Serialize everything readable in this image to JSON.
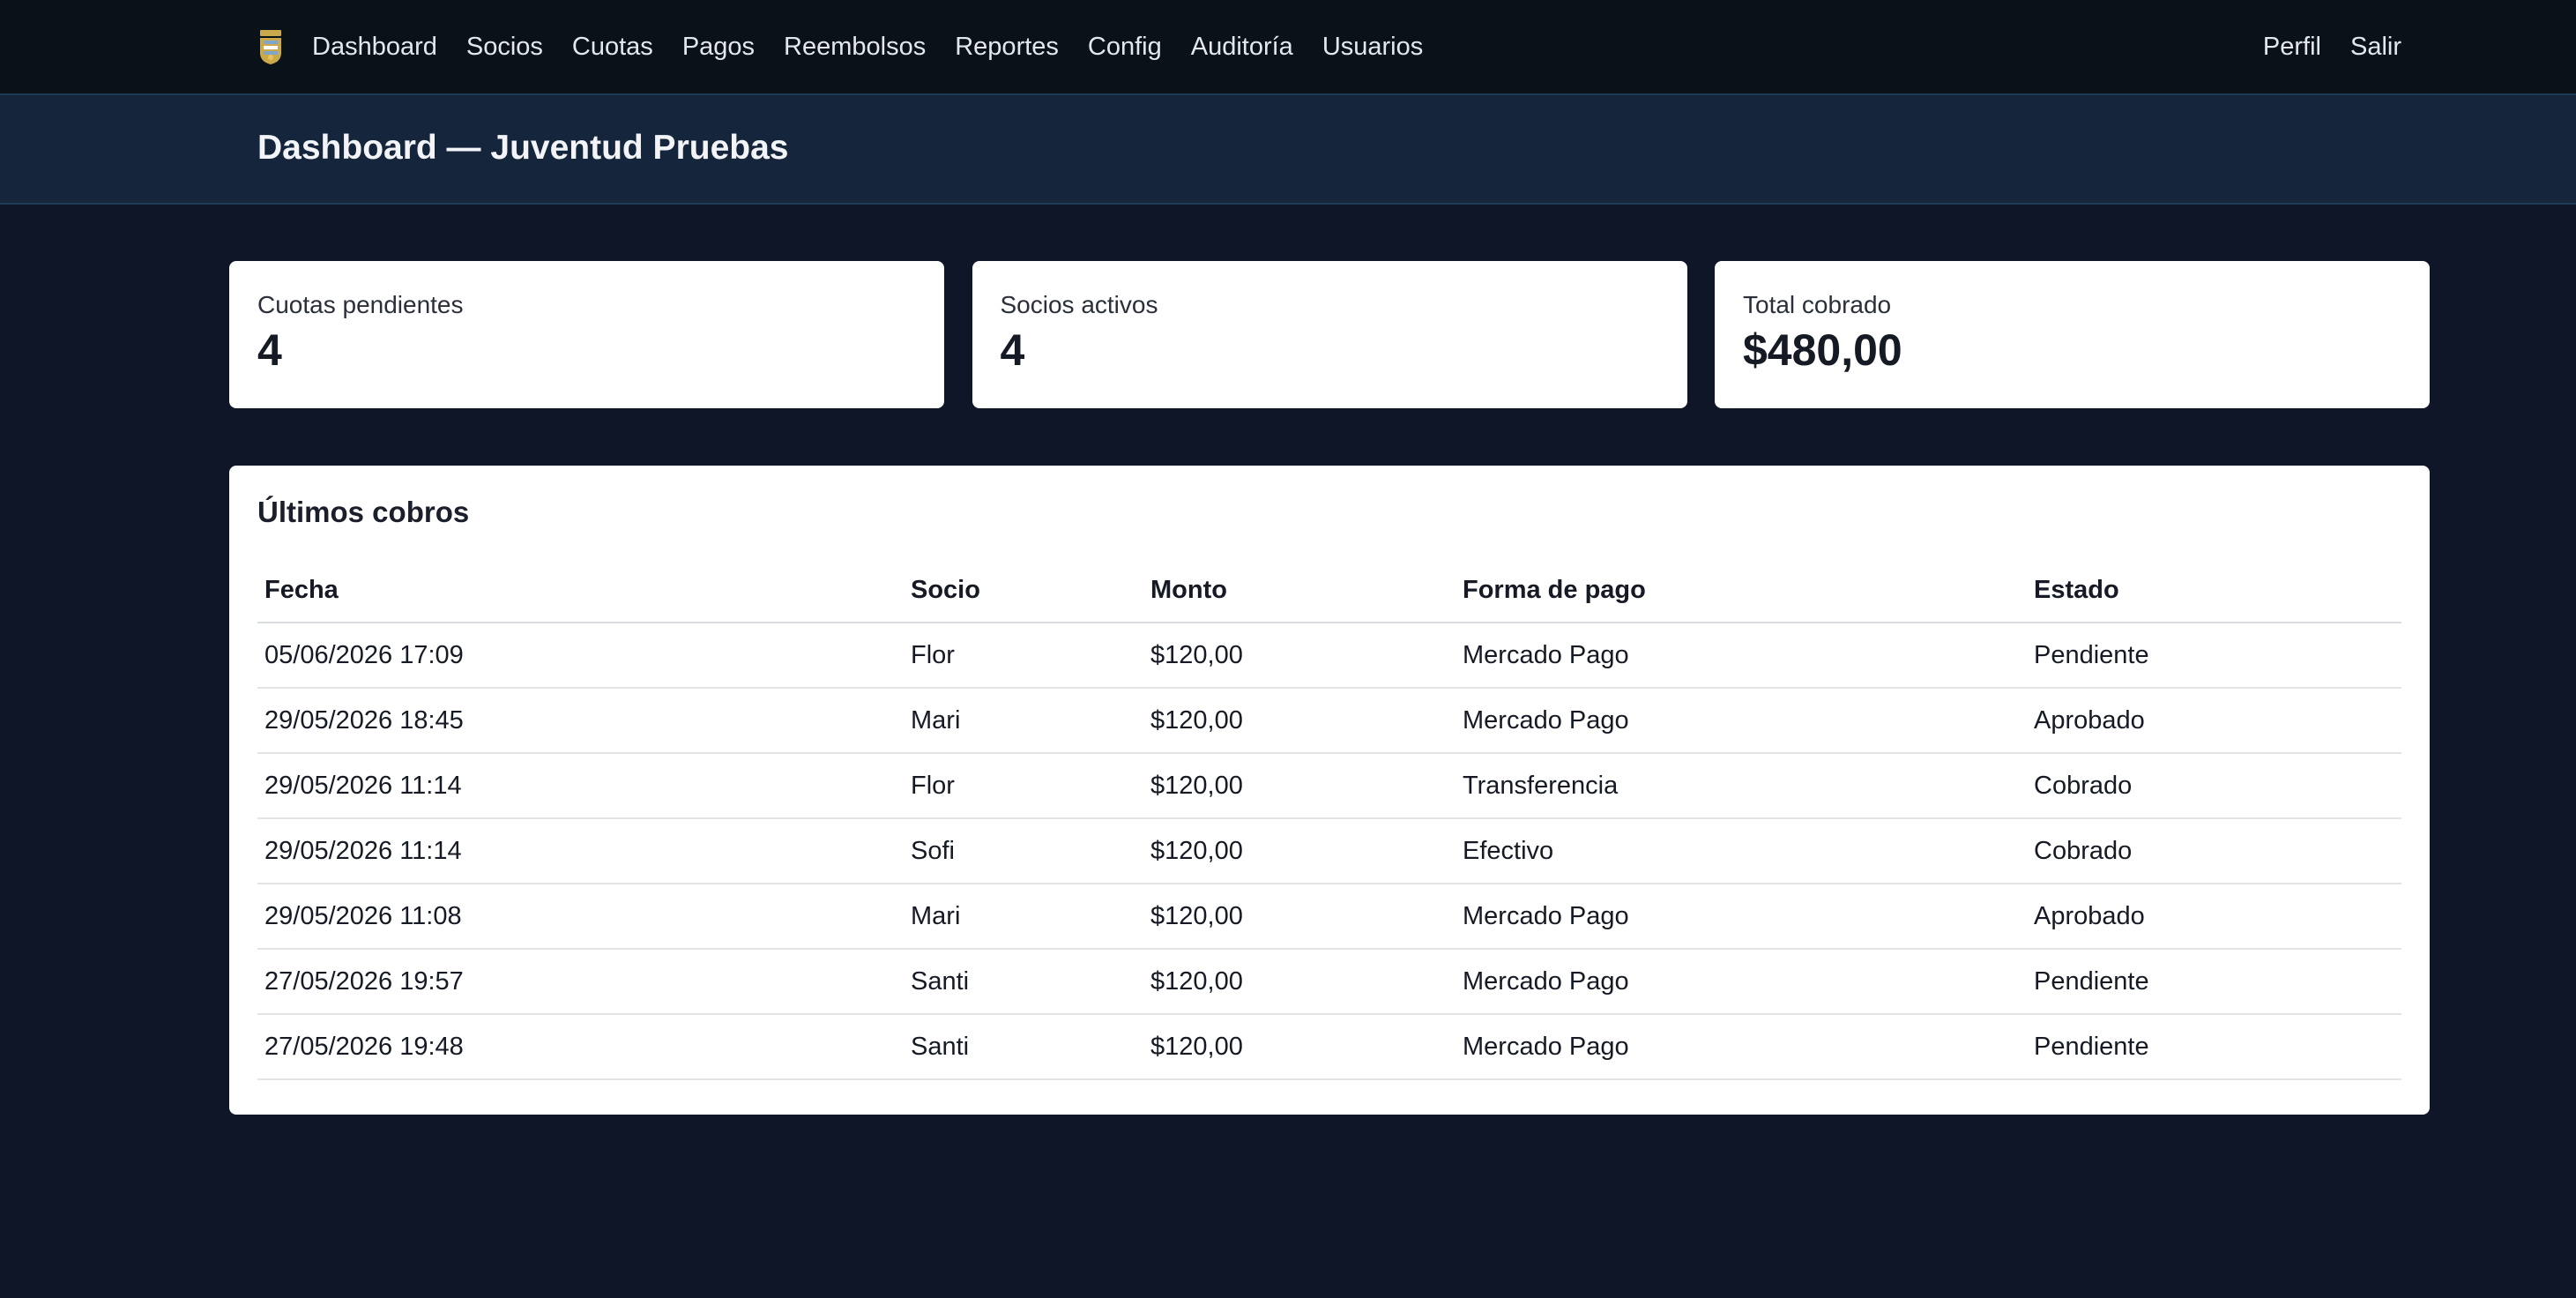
{
  "nav": {
    "logo_icon": "club-crest-icon",
    "links": [
      {
        "label": "Dashboard"
      },
      {
        "label": "Socios"
      },
      {
        "label": "Cuotas"
      },
      {
        "label": "Pagos"
      },
      {
        "label": "Reembolsos"
      },
      {
        "label": "Reportes"
      },
      {
        "label": "Config"
      },
      {
        "label": "Auditoría"
      },
      {
        "label": "Usuarios"
      }
    ],
    "right": [
      {
        "label": "Perfil"
      },
      {
        "label": "Salir"
      }
    ]
  },
  "header": {
    "title": "Dashboard — Juventud Pruebas"
  },
  "stats": [
    {
      "label": "Cuotas pendientes",
      "value": "4"
    },
    {
      "label": "Socios activos",
      "value": "4"
    },
    {
      "label": "Total cobrado",
      "value": "$480,00"
    }
  ],
  "cobros": {
    "title": "Últimos cobros",
    "columns": [
      "Fecha",
      "Socio",
      "Monto",
      "Forma de pago",
      "Estado"
    ],
    "rows": [
      [
        "05/06/2026 17:09",
        "Flor",
        "$120,00",
        "Mercado Pago",
        "Pendiente"
      ],
      [
        "29/05/2026 18:45",
        "Mari",
        "$120,00",
        "Mercado Pago",
        "Aprobado"
      ],
      [
        "29/05/2026 11:14",
        "Flor",
        "$120,00",
        "Transferencia",
        "Cobrado"
      ],
      [
        "29/05/2026 11:14",
        "Sofi",
        "$120,00",
        "Efectivo",
        "Cobrado"
      ],
      [
        "29/05/2026 11:08",
        "Mari",
        "$120,00",
        "Mercado Pago",
        "Aprobado"
      ],
      [
        "27/05/2026 19:57",
        "Santi",
        "$120,00",
        "Mercado Pago",
        "Pendiente"
      ],
      [
        "27/05/2026 19:48",
        "Santi",
        "$120,00",
        "Mercado Pago",
        "Pendiente"
      ]
    ]
  },
  "colors": {
    "page_bg": "#0e1628",
    "nav_bg": "#0b1119",
    "header_bg": "#15253c",
    "card_bg": "#ffffff",
    "logo_gold": "#c9a94a"
  }
}
